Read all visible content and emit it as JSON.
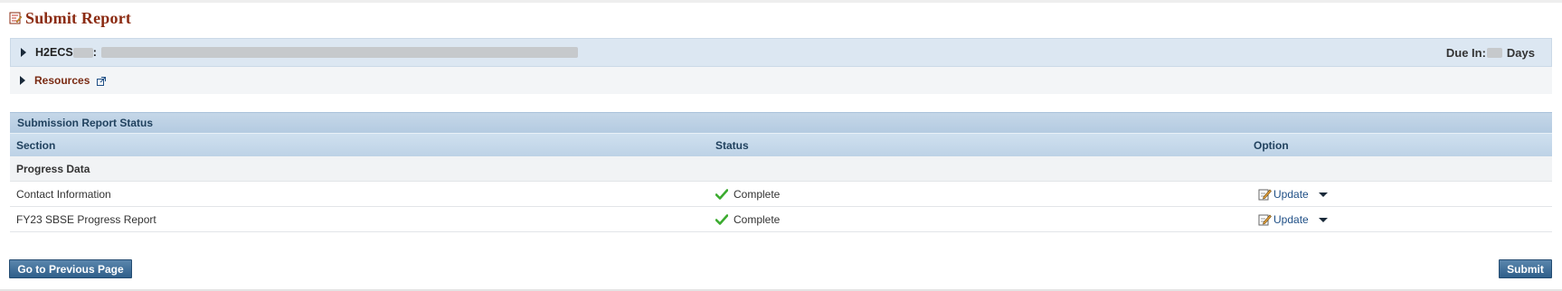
{
  "page": {
    "title": "Submit Report"
  },
  "project": {
    "id_prefix": "H2ECS",
    "id_separator": ":",
    "due_label": "Due In:",
    "due_unit": "Days",
    "resources_label": "Resources"
  },
  "table": {
    "caption": "Submission Report Status",
    "columns": [
      "Section",
      "Status",
      "Option"
    ],
    "group": "Progress Data",
    "rows": [
      {
        "section": "Contact Information",
        "status": "Complete",
        "option": "Update"
      },
      {
        "section": "FY23 SBSE Progress Report",
        "status": "Complete",
        "option": "Update"
      }
    ]
  },
  "actions": {
    "previous_label": "Go to Previous Page",
    "submit_label": "Submit"
  },
  "icons": {
    "title": "report-edit-icon",
    "expand": "triangle-right-icon",
    "external": "external-link-icon",
    "status": "checkmark-icon",
    "update": "edit-pencil-icon",
    "dropdown": "caret-down-icon"
  },
  "colors": {
    "title": "#8b2b12",
    "link": "#1f4f86",
    "header_band": "#c5d7e8",
    "button": "#2f5f8a",
    "check": "#3bab2f"
  }
}
